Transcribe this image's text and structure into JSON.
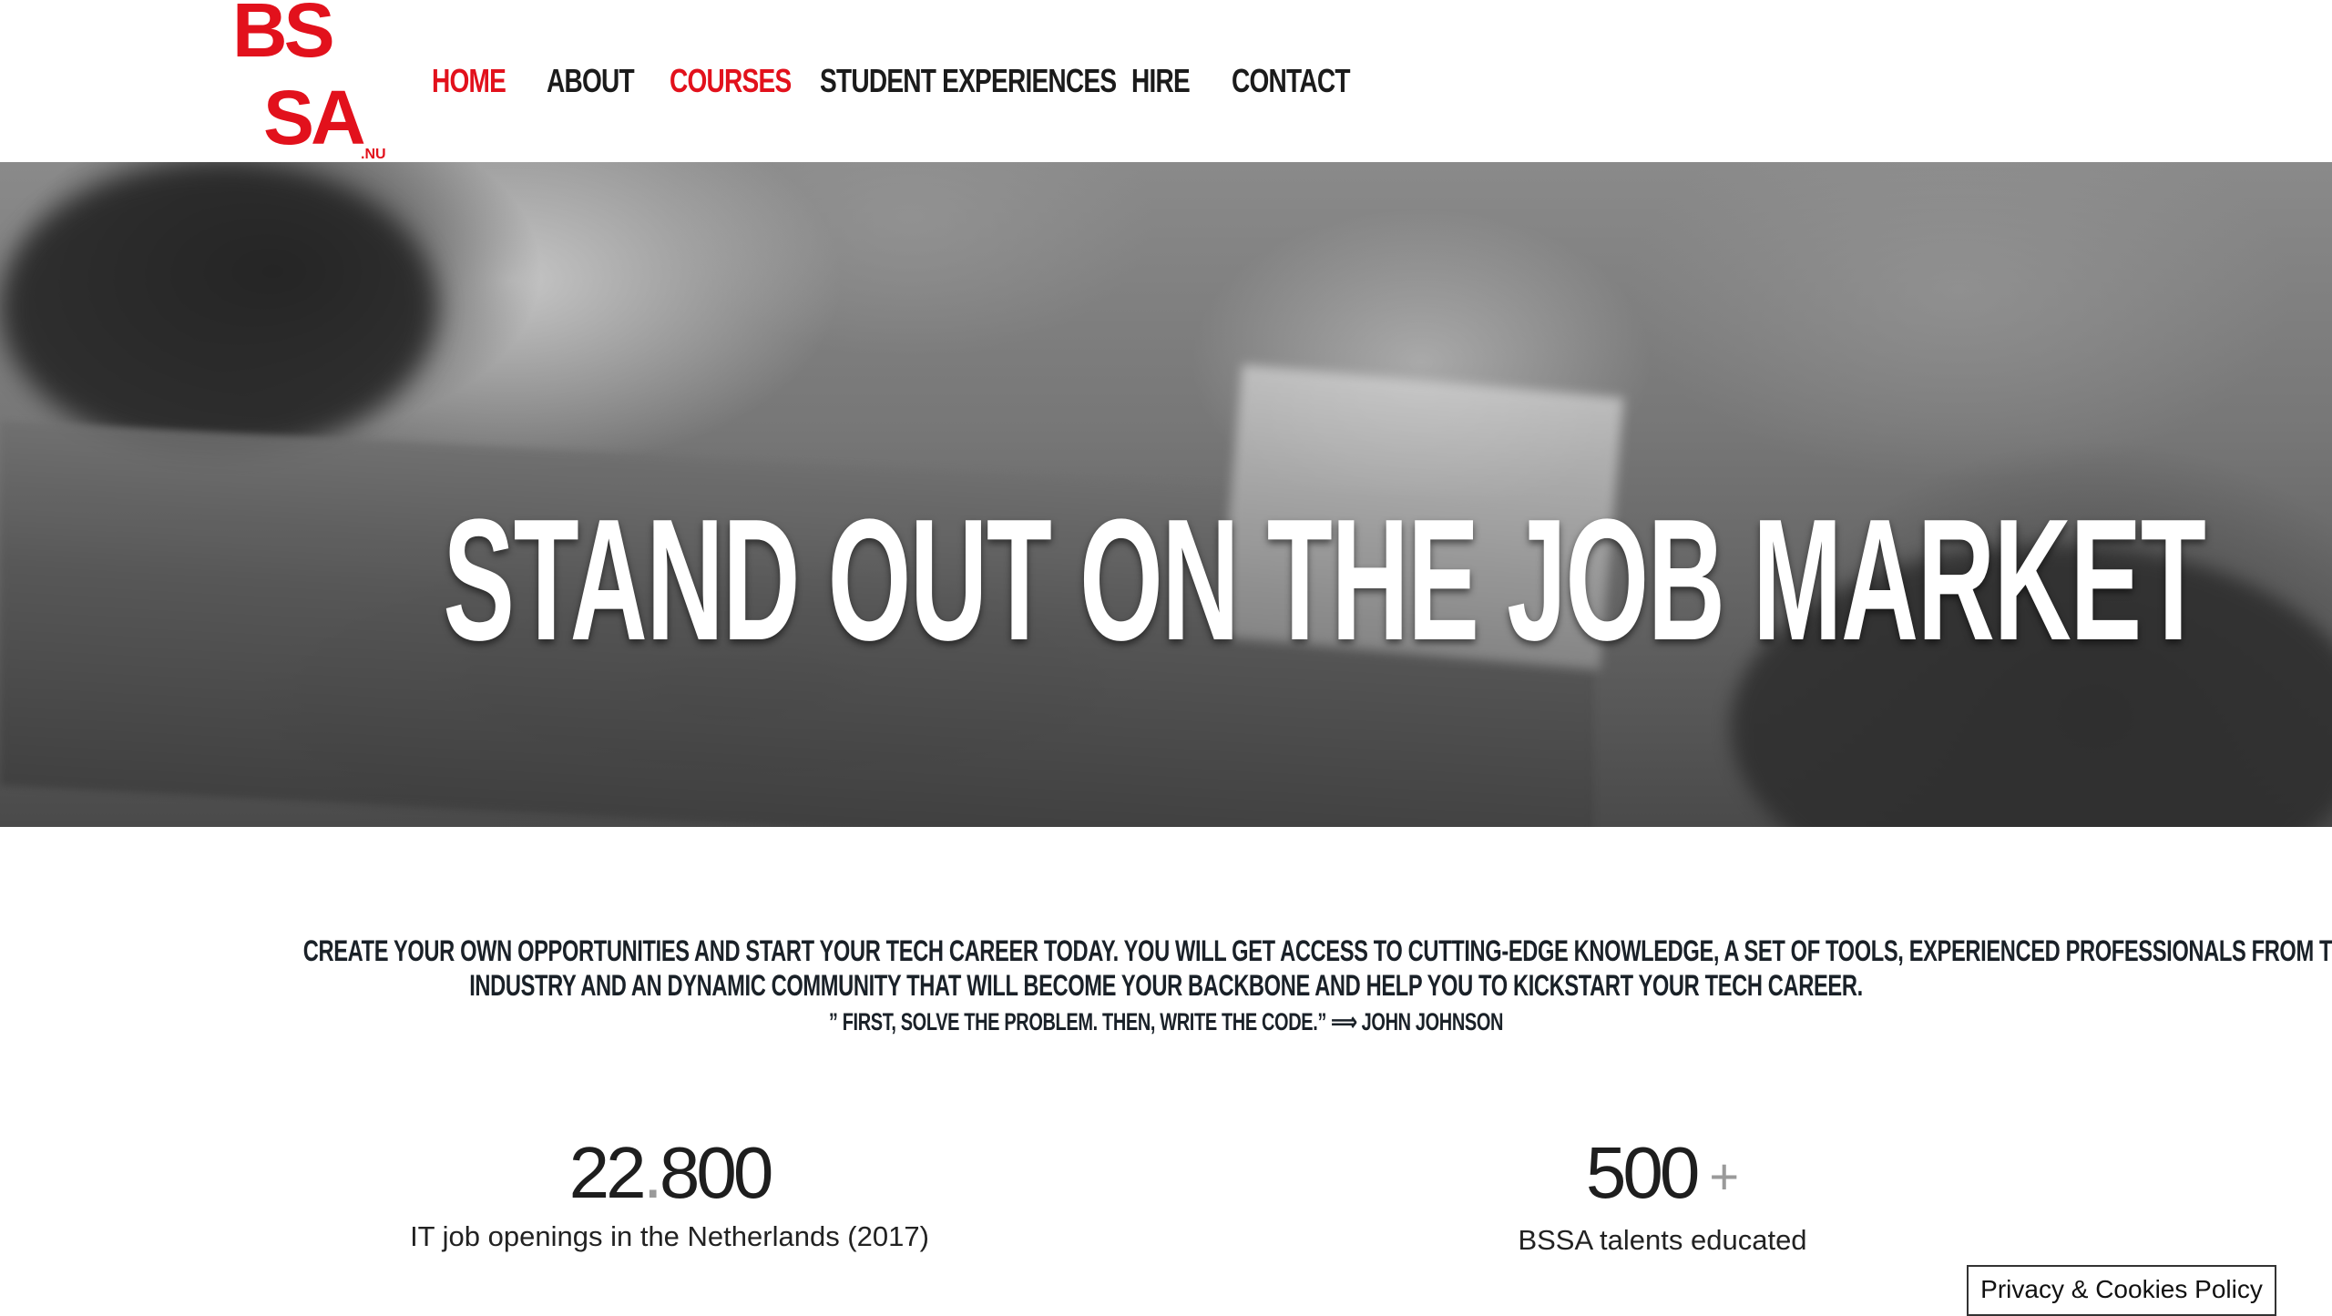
{
  "header": {
    "logo": {
      "letters_top": "BS",
      "letters_bottom": "SA",
      "suffix": ".NU",
      "brand_color": "#e2111c"
    },
    "nav": [
      {
        "label": "HOME",
        "active": true
      },
      {
        "label": "ABOUT",
        "active": false
      },
      {
        "label": "COURSES",
        "active": true
      },
      {
        "label": "STUDENT EXPERIENCES",
        "active": false
      },
      {
        "label": "HIRE",
        "active": false
      },
      {
        "label": "CONTACT",
        "active": false
      }
    ]
  },
  "hero": {
    "title": "STAND OUT ON THE JOB MARKET"
  },
  "intro": {
    "line1": "CREATE YOUR OWN OPPORTUNITIES AND START YOUR TECH CAREER TODAY. YOU WILL GET ACCESS TO CUTTING-EDGE KNOWLEDGE, A SET OF TOOLS, EXPERIENCED PROFESSIONALS FROM THE",
    "line2": "INDUSTRY AND AN DYNAMIC COMMUNITY THAT WILL BECOME YOUR BACKBONE AND HELP YOU TO KICKSTART YOUR TECH CAREER.",
    "quote": "” FIRST, SOLVE THE PROBLEM. THEN, WRITE THE CODE.” ⟹ JOHN JOHNSON"
  },
  "stats": [
    {
      "number_part1": "22",
      "separator": ".",
      "number_part2": "800",
      "label": "IT job openings in the Netherlands (2017)"
    },
    {
      "number": "500",
      "suffix": "+",
      "label": "BSSA talents educated"
    }
  ],
  "cookie_button": {
    "label": "Privacy & Cookies Policy"
  },
  "colors": {
    "accent": "#e2111c",
    "nav_text": "#1b1b1b",
    "body_text": "#1a2128"
  }
}
